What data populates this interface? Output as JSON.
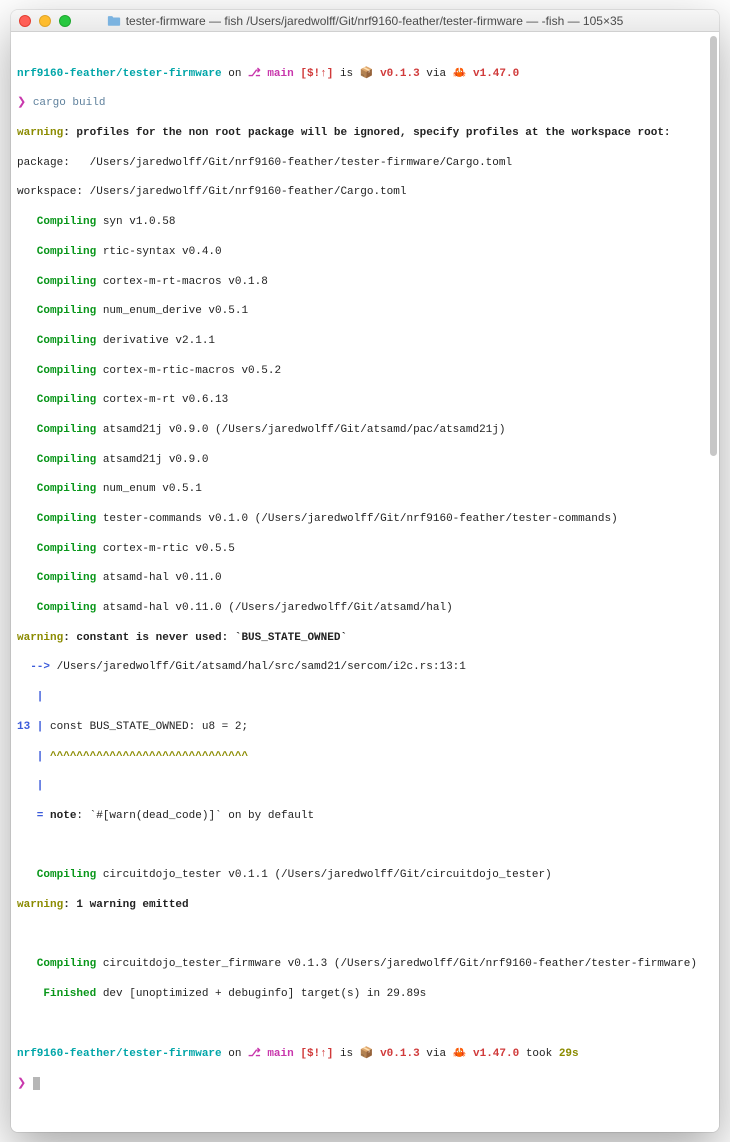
{
  "titlebar": {
    "title": "tester-firmware — fish /Users/jaredwolff/Git/nrf9160-feather/tester-firmware — -fish — 105×35"
  },
  "prompt1": {
    "path": "nrf9160-feather/tester-firmware",
    "on": " on ",
    "branch_icon": "⎇",
    "branch": " main ",
    "status": "[$!↑]",
    "is": " is ",
    "pkg_icon": "📦",
    "pkg": " v0.1.3",
    "via": " via ",
    "rust_icon": "🦀",
    "rust": " v1.47.0"
  },
  "cmd": {
    "symbol": "❯",
    "cmd1": " cargo",
    "cmd2": " build"
  },
  "warn_profiles": {
    "label": "warning",
    "text": ": profiles for the non root package will be ignored, specify profiles at the workspace root:"
  },
  "package_line": "package:   /Users/jaredwolff/Git/nrf9160-feather/tester-firmware/Cargo.toml",
  "workspace_line": "workspace: /Users/jaredwolff/Git/nrf9160-feather/Cargo.toml",
  "compiling_label": "   Compiling",
  "compiles": [
    " syn v1.0.58",
    " rtic-syntax v0.4.0",
    " cortex-m-rt-macros v0.1.8",
    " num_enum_derive v0.5.1",
    " derivative v2.1.1",
    " cortex-m-rtic-macros v0.5.2",
    " cortex-m-rt v0.6.13",
    " atsamd21j v0.9.0 (/Users/jaredwolff/Git/atsamd/pac/atsamd21j)",
    " atsamd21j v0.9.0",
    " num_enum v0.5.1",
    " tester-commands v0.1.0 (/Users/jaredwolff/Git/nrf9160-feather/tester-commands)",
    " cortex-m-rtic v0.5.5",
    " atsamd-hal v0.11.0",
    " atsamd-hal v0.11.0 (/Users/jaredwolff/Git/atsamd/hal)"
  ],
  "warn_const": {
    "label": "warning",
    "text": ": constant is never used: `BUS_STATE_OWNED`"
  },
  "arrow": "  -->",
  "loc": " /Users/jaredwolff/Git/atsamd/hal/src/samd21/sercom/i2c.rs:13:1",
  "gutter_empty": "   |",
  "gutter_num": "13",
  "gutter_num_post": " | ",
  "code_line": "const BUS_STATE_OWNED: u8 = 2;",
  "underline_pre": "   | ",
  "underline": "^^^^^^^^^^^^^^^^^^^^^^^^^^^^^^",
  "note_eq": "   = ",
  "note_label": "note",
  "note_text": ": `#[warn(dead_code)]` on by default",
  "compile_tester": " circuitdojo_tester v0.1.1 (/Users/jaredwolff/Git/circuitdojo_tester)",
  "warn_emitted": {
    "label": "warning",
    "text": ": 1 warning emitted"
  },
  "compile_fw": " circuitdojo_tester_firmware v0.1.3 (/Users/jaredwolff/Git/nrf9160-feather/tester-firmware)",
  "finished_label": "    Finished",
  "finished_text": " dev [unoptimized + debuginfo] target(s) in 29.89s",
  "prompt2": {
    "took": " took ",
    "took_val": "29s"
  },
  "final_symbol": "❯"
}
